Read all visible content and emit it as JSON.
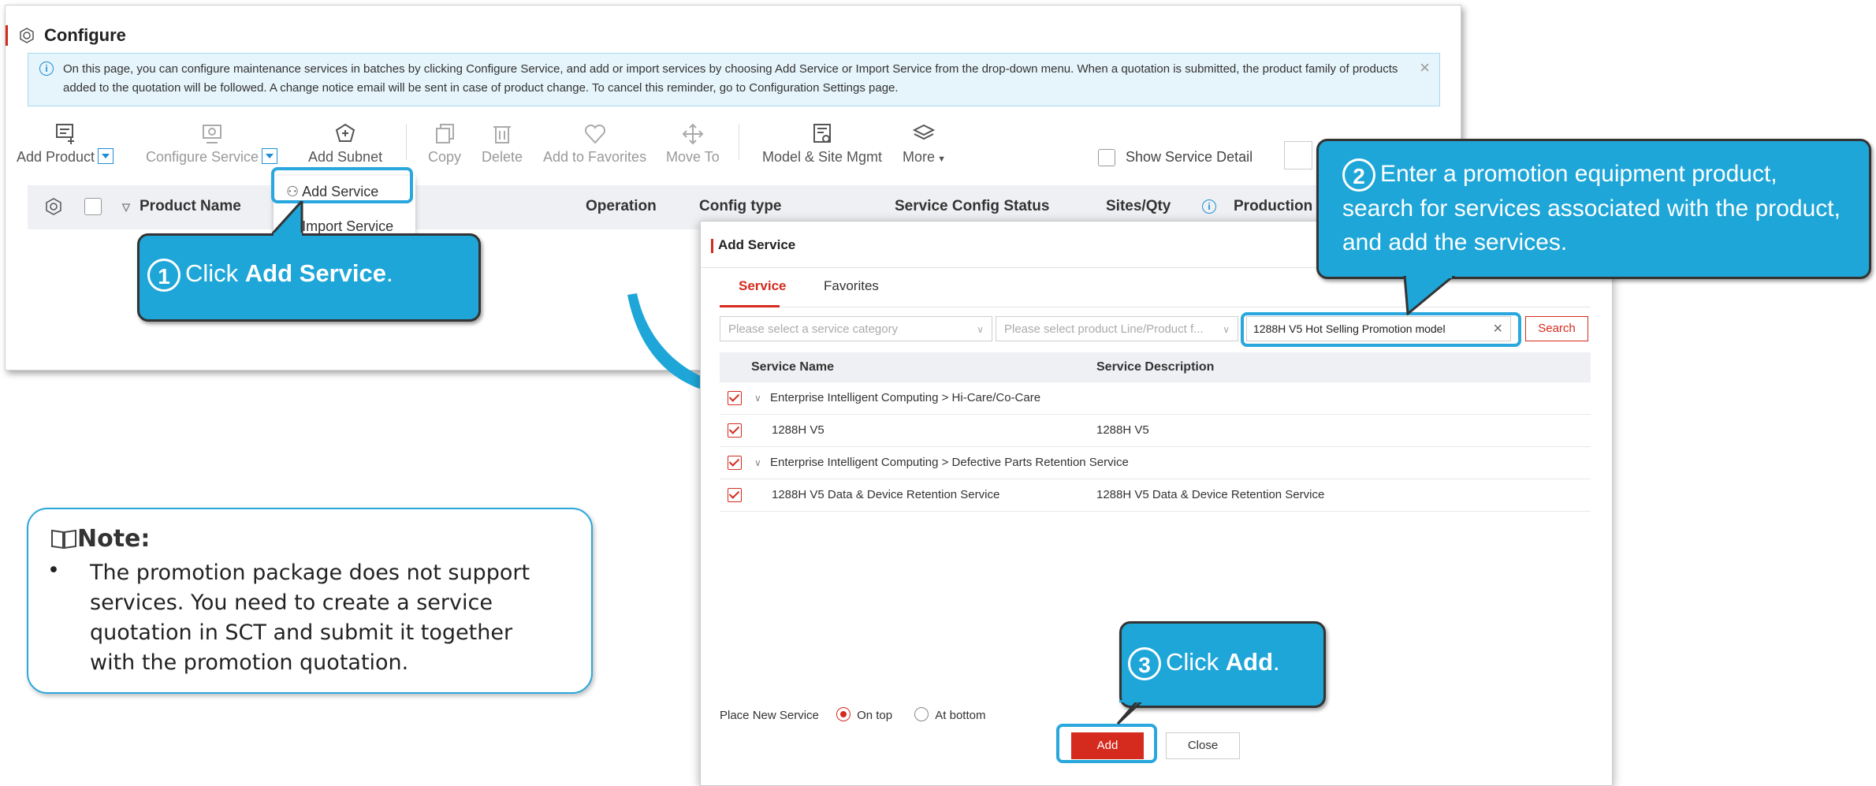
{
  "window": {
    "title": "Configure",
    "info": "On this page, you can configure maintenance services in batches by clicking Configure Service, and add or import services by choosing Add Service or Import Service from the drop-down menu. When a quotation is submitted, the product family of products added to the quotation will be followed. A change notice email will be sent in case of product change. To cancel this reminder, go to Configuration Settings page."
  },
  "toolbar": {
    "add_product": "Add Product",
    "configure_service": "Configure Service",
    "add_subnet": "Add Subnet",
    "copy": "Copy",
    "delete": "Delete",
    "add_to_favorites": "Add to Favorites",
    "move_to": "Move To",
    "model_site_mgmt": "Model & Site Mgmt",
    "more": "More",
    "show_service_detail": "Show Service Detail"
  },
  "dropdown": {
    "add_service": "Add Service",
    "import_service": "Import Service"
  },
  "table": {
    "columns": [
      "Product Name",
      "Operation",
      "Config type",
      "Service Config Status",
      "Sites/Qty",
      "Production L"
    ]
  },
  "dialog": {
    "title": "Add Service",
    "tabs": [
      "Service",
      "Favorites"
    ],
    "category_placeholder": "Please select a service category",
    "product_line_placeholder": "Please select product Line/Product f...",
    "search_value": "1288H V5 Hot Selling Promotion model",
    "search_button": "Search",
    "columns": [
      "Service Name",
      "Service Description"
    ],
    "rows": [
      {
        "name": "Enterprise Intelligent Computing > Hi-Care/Co-Care",
        "description": "",
        "group": true
      },
      {
        "name": "1288H V5",
        "description": "1288H V5",
        "group": false
      },
      {
        "name": "Enterprise Intelligent Computing > Defective Parts Retention Service",
        "description": "",
        "group": true
      },
      {
        "name": "1288H V5 Data & Device Retention Service",
        "description": "1288H V5 Data & Device Retention Service",
        "group": false
      }
    ],
    "place_label": "Place New Service",
    "on_top": "On top",
    "at_bottom": "At bottom",
    "add_button": "Add",
    "close_button": "Close"
  },
  "callouts": {
    "step1_num": "1",
    "step1_pre": "Click ",
    "step1_bold": "Add Service",
    "step1_post": ".",
    "step2_num": "2",
    "step2_text": "Enter a promotion equipment product, search for services associated with the product, and add the services.",
    "step3_num": "3",
    "step3_pre": "Click ",
    "step3_bold": "Add",
    "step3_post": "."
  },
  "note": {
    "title": "Note:",
    "bullet": "The promotion package does not support services. You need to create a service quotation in SCT and submit it together with the promotion quotation."
  },
  "colors": {
    "accent_red": "#d52b1e",
    "callout_blue": "#1ea6d8",
    "info_bg": "#e6f4fb"
  }
}
